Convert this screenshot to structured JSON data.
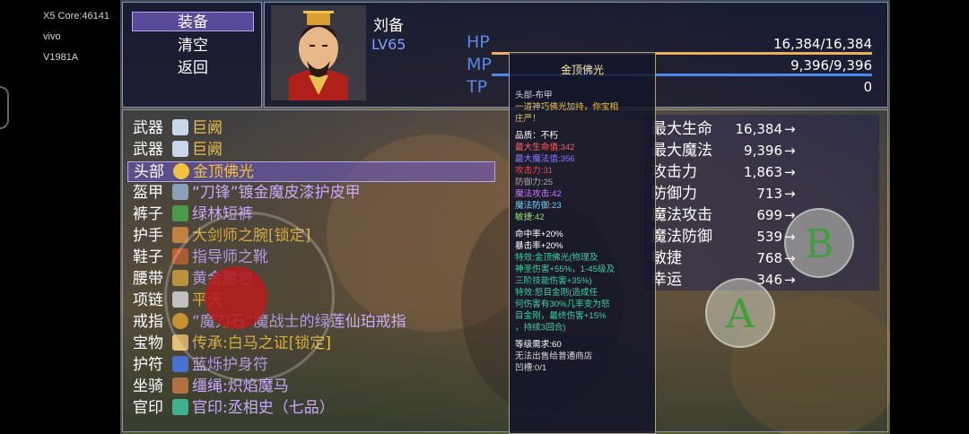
{
  "system_overlay": {
    "line1": "X5 Core:46141",
    "line2": "vivo",
    "line3": "V1981A"
  },
  "menu": {
    "equip": "装备",
    "clear": "清空",
    "back": "返回"
  },
  "character": {
    "name": "刘备",
    "level": "LV65"
  },
  "stats": {
    "hp_label": "HP",
    "hp_value": "16,384/16,384",
    "mp_label": "MP",
    "mp_value": "9,396/9,396",
    "tp_label": "TP",
    "tp_value": "0"
  },
  "equipment": [
    {
      "slot": "武器",
      "name": "巨阙",
      "color": "#f0c040",
      "icon": "sword-icon"
    },
    {
      "slot": "武器",
      "name": "巨阙",
      "color": "#f0c040",
      "icon": "sword-icon"
    },
    {
      "slot": "头部",
      "name": "金顶佛光",
      "color": "#f0c040",
      "icon": "halo-icon"
    },
    {
      "slot": "盔甲",
      "name": "“刀锋”镀金魔皮漆护皮甲",
      "color": "#c9a8ff",
      "icon": "armor-icon"
    },
    {
      "slot": "裤子",
      "name": "绿林短裤",
      "color": "#c9a8ff",
      "icon": "pants-icon"
    },
    {
      "slot": "护手",
      "name": "大剑师之腕[锁定]",
      "color": "#f0c040",
      "icon": "bracer-icon"
    },
    {
      "slot": "鞋子",
      "name": "指导师之靴",
      "color": "#c9a8ff",
      "icon": "boots-icon"
    },
    {
      "slot": "腰带",
      "name": "黄金腰包",
      "color": "#c9a8ff",
      "icon": "belt-icon"
    },
    {
      "slot": "项链",
      "name": "平天",
      "color": "#f0c040",
      "icon": "necklace-icon"
    },
    {
      "slot": "戒指",
      "name": "“魔刀石”魔战士的绿莲仙珀戒指",
      "color": "#c9a8ff",
      "icon": "ring-icon"
    },
    {
      "slot": "宝物",
      "name": "传承:白马之证[锁定]",
      "color": "#f0c040",
      "icon": "treasure-icon"
    },
    {
      "slot": "护符",
      "name": "蓝烁护身符",
      "color": "#c9a8ff",
      "icon": "amulet-icon"
    },
    {
      "slot": "坐骑",
      "name": "缰绳:炽焰魔马",
      "color": "#c9a8ff",
      "icon": "rein-icon"
    },
    {
      "slot": "官印",
      "name": "官印:丞相史（七品）",
      "color": "#c9a8ff",
      "icon": "seal-icon"
    }
  ],
  "tooltip": {
    "title": "金顶佛光",
    "lines": [
      {
        "text": "头部-布甲",
        "color": "#d8d8d8"
      },
      {
        "text": "一道神巧佛光加持，你宝相",
        "color": "#f0c040"
      },
      {
        "text": "庄严！",
        "color": "#f0c040"
      },
      {
        "text": "品质：不朽",
        "color": "#ffffff"
      },
      {
        "text": "最大生命值:342",
        "color": "#ff6060"
      },
      {
        "text": "最大魔法值:356",
        "color": "#8a7cff"
      },
      {
        "text": "攻击力:31",
        "color": "#ff4040"
      },
      {
        "text": "防御力:25",
        "color": "#a8a8a8"
      },
      {
        "text": "魔法攻击:42",
        "color": "#d070ff"
      },
      {
        "text": "魔法防御:23",
        "color": "#70d0ff"
      },
      {
        "text": "敏捷:42",
        "color": "#90e070"
      },
      {
        "text": "命中率+20%",
        "color": "#ffffff"
      },
      {
        "text": "暴击率+20%",
        "color": "#ffffff"
      },
      {
        "text": "特效:金顶佛光(物理及",
        "color": "#40d0a0"
      },
      {
        "text": "神圣伤害+55%，1-45级及",
        "color": "#40d0a0"
      },
      {
        "text": "三阶技能伤害+35%)",
        "color": "#40d0a0"
      },
      {
        "text": "特效:怒目金刚(造成任",
        "color": "#40d0a0"
      },
      {
        "text": "何伤害有30%几率变为怒",
        "color": "#40d0a0"
      },
      {
        "text": "目金刚，最终伤害+15%",
        "color": "#40d0a0"
      },
      {
        "text": "，持续3回合)",
        "color": "#40d0a0"
      },
      {
        "text": "等级需求:60",
        "color": "#ffffff"
      },
      {
        "text": "无法出售给普通商店",
        "color": "#d8d8d8"
      },
      {
        "text": "凹槽:0/1",
        "color": "#d8d8d8"
      }
    ]
  },
  "attributes": [
    {
      "label": "最大生命",
      "value": "16,384"
    },
    {
      "label": "最大魔法",
      "value": "9,396"
    },
    {
      "label": "攻击力",
      "value": "1,863"
    },
    {
      "label": "防御力",
      "value": "713"
    },
    {
      "label": "魔法攻击",
      "value": "699"
    },
    {
      "label": "魔法防御",
      "value": "539"
    },
    {
      "label": "敏捷",
      "value": "768"
    },
    {
      "label": "幸运",
      "value": "346"
    }
  ],
  "arrow": "→",
  "controls": {
    "b_label": "B",
    "a_label": "A"
  },
  "colors": {
    "hp_bar": "#e8b060",
    "mp_bar": "#4a8af0",
    "selected_row": "#6e5ac8"
  }
}
